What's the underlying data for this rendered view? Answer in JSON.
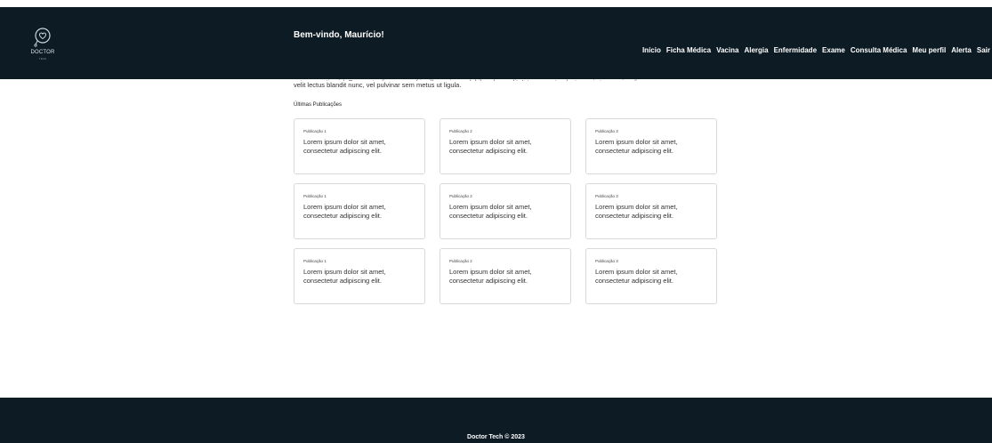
{
  "header": {
    "logo_text": "DOCTOR",
    "logo_subtext": "TECH",
    "welcome": "Bem-vindo, Maurício!",
    "nav": [
      "Início",
      "Ficha Médica",
      "Vacina",
      "Alergia",
      "Enfermidade",
      "Exame",
      "Consulta Médica",
      "Meu perfil",
      "Alerta",
      "Sair"
    ]
  },
  "intro": {
    "line_cut": "est venenatis nisl. Fusce ut odio semper, fringilla sapien sed, bibendum velit. Integer auctor, lectus quis tempor iaculis,",
    "line": "velit lectus blandit nunc, vel pulvinar sem metus ut ligula."
  },
  "section": {
    "title": "Últimas Publicações"
  },
  "cards": [
    {
      "title": "Publicação 1",
      "text": "Lorem ipsum dolor sit amet, consectetur adipiscing elit."
    },
    {
      "title": "Publicação 2",
      "text": "Lorem ipsum dolor sit amet, consectetur adipiscing elit."
    },
    {
      "title": "Publicação 3",
      "text": "Lorem ipsum dolor sit amet, consectetur adipiscing elit."
    },
    {
      "title": "Publicação 1",
      "text": "Lorem ipsum dolor sit amet, consectetur adipiscing elit."
    },
    {
      "title": "Publicação 2",
      "text": "Lorem ipsum dolor sit amet, consectetur adipiscing elit."
    },
    {
      "title": "Publicação 3",
      "text": "Lorem ipsum dolor sit amet, consectetur adipiscing elit."
    },
    {
      "title": "Publicação 1",
      "text": "Lorem ipsum dolor sit amet, consectetur adipiscing elit."
    },
    {
      "title": "Publicação 2",
      "text": "Lorem ipsum dolor sit amet, consectetur adipiscing elit."
    },
    {
      "title": "Publicação 3",
      "text": "Lorem ipsum dolor sit amet, consectetur adipiscing elit."
    }
  ],
  "footer": {
    "text": "Doctor Tech © 2023"
  },
  "colors": {
    "header_bg": "#0d1b24",
    "footer_bg": "#0d1b24",
    "card_border": "#d9d9d9"
  },
  "icons": {
    "logo": "heart-stethoscope-icon"
  }
}
